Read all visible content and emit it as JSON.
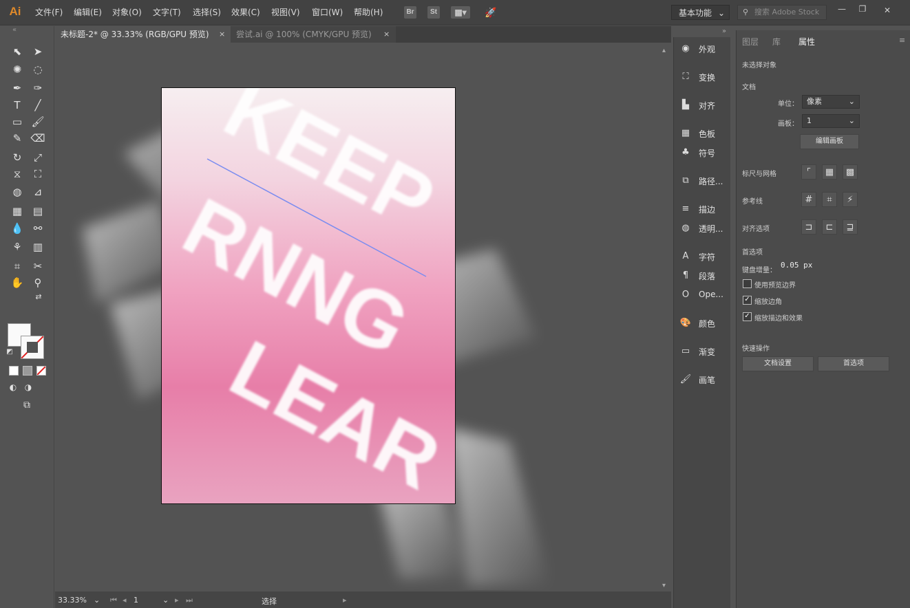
{
  "app": {
    "logo": "Ai",
    "menu": [
      "文件(F)",
      "编辑(E)",
      "对象(O)",
      "文字(T)",
      "选择(S)",
      "效果(C)",
      "视图(V)",
      "窗口(W)",
      "帮助(H)"
    ],
    "bridge_label": "Br",
    "stock_label": "St",
    "workspace": "基本功能",
    "search_placeholder": "搜索 Adobe Stock"
  },
  "tabs": [
    {
      "label": "未标题-2* @ 33.33% (RGB/GPU 预览)",
      "close": "×"
    },
    {
      "label": "尝试.ai @ 100% (CMYK/GPU 预览)",
      "close": "×"
    }
  ],
  "artwork": {
    "lines": [
      "KEEP",
      "RNNG",
      "LEAR"
    ]
  },
  "panel_icons": [
    {
      "icon": "appearance-icon",
      "label": "外观"
    },
    {
      "icon": "transform-icon",
      "label": "变换"
    },
    {
      "icon": "align-icon",
      "label": "对齐"
    },
    {
      "icon": "swatches-icon",
      "label": "色板"
    },
    {
      "icon": "symbols-icon",
      "label": "符号"
    },
    {
      "icon": "pathfinder-icon",
      "label": "路径..."
    },
    {
      "icon": "stroke-icon",
      "label": "描边"
    },
    {
      "icon": "transparency-icon",
      "label": "透明..."
    },
    {
      "icon": "character-icon",
      "label": "字符"
    },
    {
      "icon": "paragraph-icon",
      "label": "段落"
    },
    {
      "icon": "opentype-icon",
      "label": "Ope..."
    },
    {
      "icon": "color-icon",
      "label": "颜色"
    },
    {
      "icon": "gradient-icon",
      "label": "渐变"
    },
    {
      "icon": "brushes-icon",
      "label": "画笔"
    }
  ],
  "properties": {
    "tabs": [
      "图层",
      "库",
      "属性"
    ],
    "no_selection": "未选择对象",
    "document_label": "文档",
    "unit_label": "单位：",
    "unit_value": "像素",
    "artboard_label": "画板：",
    "artboard_value": "1",
    "edit_artboards": "编辑画板",
    "rulers_grids": "标尺与网格",
    "guides": "参考线",
    "snap_options": "对齐选项",
    "preferences": "首选项",
    "keyboard_increment_label": "键盘增量：",
    "keyboard_increment_value": "0.05 px",
    "use_preview_bounds": "使用预览边界",
    "scale_corners": "缩放边角",
    "scale_strokes": "缩放描边和效果",
    "quick_actions": "快速操作",
    "doc_setup_button": "文档设置",
    "preferences_button": "首选项",
    "checks": {
      "use_preview_bounds": false,
      "scale_corners": true,
      "scale_strokes": true
    }
  },
  "status": {
    "zoom": "33.33%",
    "artboard": "1",
    "tool": "选择"
  }
}
